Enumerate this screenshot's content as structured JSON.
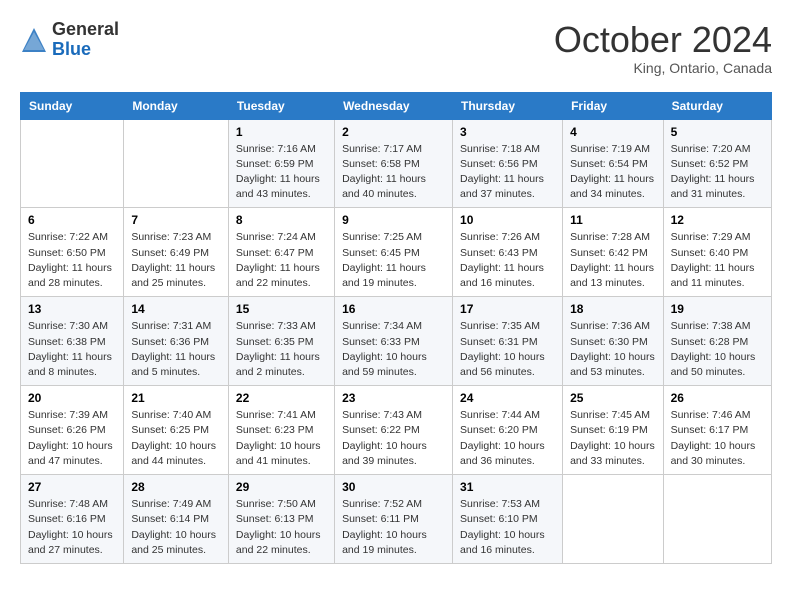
{
  "header": {
    "logo_line1": "General",
    "logo_line2": "Blue",
    "month": "October 2024",
    "location": "King, Ontario, Canada"
  },
  "weekdays": [
    "Sunday",
    "Monday",
    "Tuesday",
    "Wednesday",
    "Thursday",
    "Friday",
    "Saturday"
  ],
  "weeks": [
    [
      {
        "day": "",
        "info": ""
      },
      {
        "day": "",
        "info": ""
      },
      {
        "day": "1",
        "info": "Sunrise: 7:16 AM\nSunset: 6:59 PM\nDaylight: 11 hours and 43 minutes."
      },
      {
        "day": "2",
        "info": "Sunrise: 7:17 AM\nSunset: 6:58 PM\nDaylight: 11 hours and 40 minutes."
      },
      {
        "day": "3",
        "info": "Sunrise: 7:18 AM\nSunset: 6:56 PM\nDaylight: 11 hours and 37 minutes."
      },
      {
        "day": "4",
        "info": "Sunrise: 7:19 AM\nSunset: 6:54 PM\nDaylight: 11 hours and 34 minutes."
      },
      {
        "day": "5",
        "info": "Sunrise: 7:20 AM\nSunset: 6:52 PM\nDaylight: 11 hours and 31 minutes."
      }
    ],
    [
      {
        "day": "6",
        "info": "Sunrise: 7:22 AM\nSunset: 6:50 PM\nDaylight: 11 hours and 28 minutes."
      },
      {
        "day": "7",
        "info": "Sunrise: 7:23 AM\nSunset: 6:49 PM\nDaylight: 11 hours and 25 minutes."
      },
      {
        "day": "8",
        "info": "Sunrise: 7:24 AM\nSunset: 6:47 PM\nDaylight: 11 hours and 22 minutes."
      },
      {
        "day": "9",
        "info": "Sunrise: 7:25 AM\nSunset: 6:45 PM\nDaylight: 11 hours and 19 minutes."
      },
      {
        "day": "10",
        "info": "Sunrise: 7:26 AM\nSunset: 6:43 PM\nDaylight: 11 hours and 16 minutes."
      },
      {
        "day": "11",
        "info": "Sunrise: 7:28 AM\nSunset: 6:42 PM\nDaylight: 11 hours and 13 minutes."
      },
      {
        "day": "12",
        "info": "Sunrise: 7:29 AM\nSunset: 6:40 PM\nDaylight: 11 hours and 11 minutes."
      }
    ],
    [
      {
        "day": "13",
        "info": "Sunrise: 7:30 AM\nSunset: 6:38 PM\nDaylight: 11 hours and 8 minutes."
      },
      {
        "day": "14",
        "info": "Sunrise: 7:31 AM\nSunset: 6:36 PM\nDaylight: 11 hours and 5 minutes."
      },
      {
        "day": "15",
        "info": "Sunrise: 7:33 AM\nSunset: 6:35 PM\nDaylight: 11 hours and 2 minutes."
      },
      {
        "day": "16",
        "info": "Sunrise: 7:34 AM\nSunset: 6:33 PM\nDaylight: 10 hours and 59 minutes."
      },
      {
        "day": "17",
        "info": "Sunrise: 7:35 AM\nSunset: 6:31 PM\nDaylight: 10 hours and 56 minutes."
      },
      {
        "day": "18",
        "info": "Sunrise: 7:36 AM\nSunset: 6:30 PM\nDaylight: 10 hours and 53 minutes."
      },
      {
        "day": "19",
        "info": "Sunrise: 7:38 AM\nSunset: 6:28 PM\nDaylight: 10 hours and 50 minutes."
      }
    ],
    [
      {
        "day": "20",
        "info": "Sunrise: 7:39 AM\nSunset: 6:26 PM\nDaylight: 10 hours and 47 minutes."
      },
      {
        "day": "21",
        "info": "Sunrise: 7:40 AM\nSunset: 6:25 PM\nDaylight: 10 hours and 44 minutes."
      },
      {
        "day": "22",
        "info": "Sunrise: 7:41 AM\nSunset: 6:23 PM\nDaylight: 10 hours and 41 minutes."
      },
      {
        "day": "23",
        "info": "Sunrise: 7:43 AM\nSunset: 6:22 PM\nDaylight: 10 hours and 39 minutes."
      },
      {
        "day": "24",
        "info": "Sunrise: 7:44 AM\nSunset: 6:20 PM\nDaylight: 10 hours and 36 minutes."
      },
      {
        "day": "25",
        "info": "Sunrise: 7:45 AM\nSunset: 6:19 PM\nDaylight: 10 hours and 33 minutes."
      },
      {
        "day": "26",
        "info": "Sunrise: 7:46 AM\nSunset: 6:17 PM\nDaylight: 10 hours and 30 minutes."
      }
    ],
    [
      {
        "day": "27",
        "info": "Sunrise: 7:48 AM\nSunset: 6:16 PM\nDaylight: 10 hours and 27 minutes."
      },
      {
        "day": "28",
        "info": "Sunrise: 7:49 AM\nSunset: 6:14 PM\nDaylight: 10 hours and 25 minutes."
      },
      {
        "day": "29",
        "info": "Sunrise: 7:50 AM\nSunset: 6:13 PM\nDaylight: 10 hours and 22 minutes."
      },
      {
        "day": "30",
        "info": "Sunrise: 7:52 AM\nSunset: 6:11 PM\nDaylight: 10 hours and 19 minutes."
      },
      {
        "day": "31",
        "info": "Sunrise: 7:53 AM\nSunset: 6:10 PM\nDaylight: 10 hours and 16 minutes."
      },
      {
        "day": "",
        "info": ""
      },
      {
        "day": "",
        "info": ""
      }
    ]
  ]
}
